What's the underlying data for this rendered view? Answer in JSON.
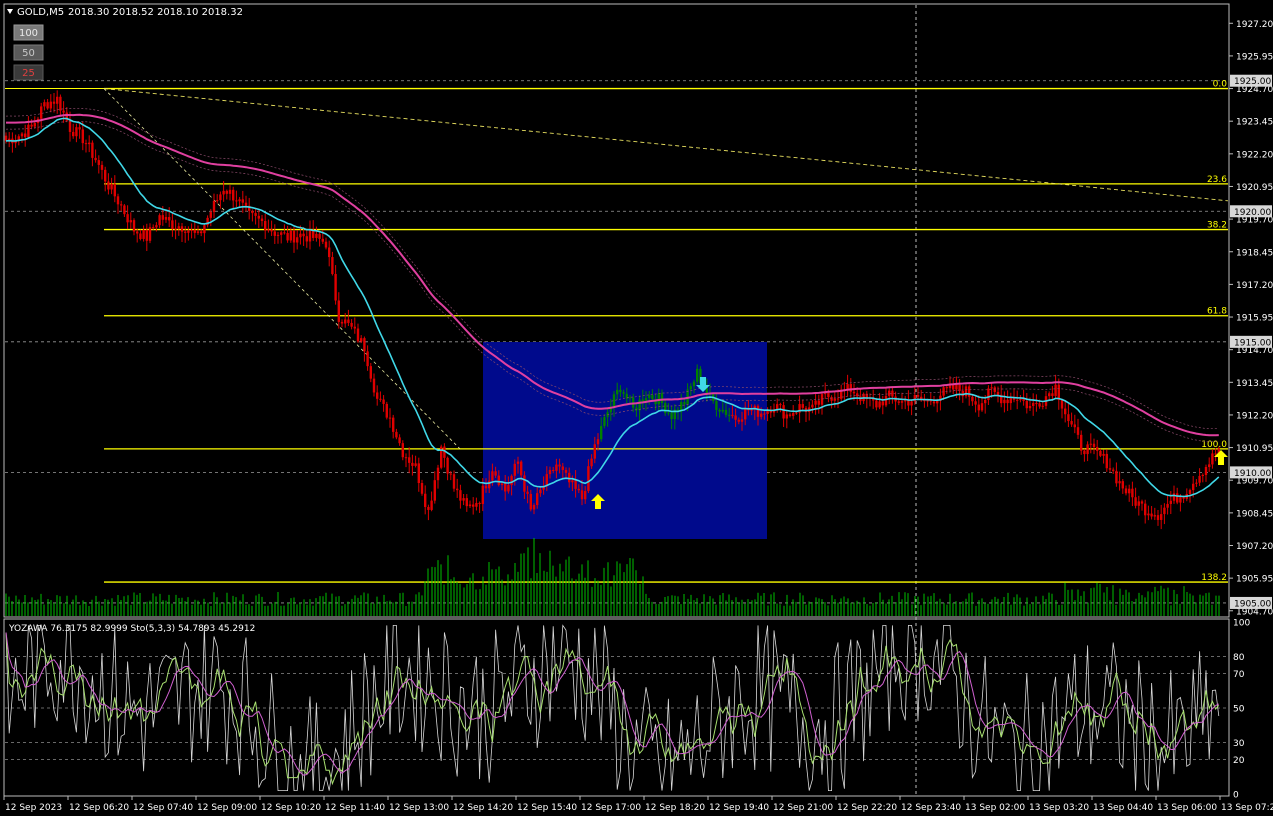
{
  "header": {
    "symbol": "GOLD,M5",
    "ohlc": "2018.30 2018.52 2018.10 2018.32"
  },
  "zoom_buttons": [
    "100",
    "50",
    "25"
  ],
  "indicator_label": "YOZAWA 76.3175 82.9999  Sto(5,3,3) 54.7893 45.2912",
  "colors": {
    "background": "#000000",
    "bear_candle": "#e00000",
    "bull_candle": "#008000",
    "fib_line": "#ffff00",
    "ma_fast": "#40d8e8",
    "ma_slow": "#e040a0",
    "box": "#000a8c",
    "volume": "#00c000"
  },
  "chart_data": {
    "type": "candlestick",
    "price_axis_ticks": [
      "1927.20",
      "1925.95",
      "1924.70",
      "1923.45",
      "1922.20",
      "1920.95",
      "1919.70",
      "1918.45",
      "1917.20",
      "1915.95",
      "1914.70",
      "1913.45",
      "1912.20",
      "1910.95",
      "1909.70",
      "1908.45",
      "1907.20",
      "1905.95",
      "1904.70"
    ],
    "price_boxes": [
      "1925.00",
      "1920.00",
      "1915.00",
      "1910.00",
      "1905.00"
    ],
    "ylim": [
      1904.5,
      1927.9
    ],
    "fib_levels": [
      {
        "label": "0.0",
        "price": 1924.7
      },
      {
        "label": "23.6",
        "price": 1921.05
      },
      {
        "label": "38.2",
        "price": 1919.3
      },
      {
        "label": "61.8",
        "price": 1916.0
      },
      {
        "label": "100.0",
        "price": 1910.9
      },
      {
        "label": "138.2",
        "price": 1905.8
      }
    ],
    "time_labels": [
      "12 Sep 2023",
      "12 Sep 06:20",
      "12 Sep 07:40",
      "12 Sep 09:00",
      "12 Sep 10:20",
      "12 Sep 11:40",
      "12 Sep 13:00",
      "12 Sep 14:20",
      "12 Sep 15:40",
      "12 Sep 17:00",
      "12 Sep 18:20",
      "12 Sep 19:40",
      "12 Sep 21:00",
      "12 Sep 22:20",
      "12 Sep 23:40",
      "13 Sep 02:00",
      "13 Sep 03:20",
      "13 Sep 04:40",
      "13 Sep 06:00",
      "13 Sep 07:20"
    ],
    "osc_ticks": [
      "100",
      "80",
      "70",
      "50",
      "30",
      "20",
      "0"
    ],
    "close_anchors": [
      [
        0,
        1922.7
      ],
      [
        4,
        1922.9
      ],
      [
        8,
        1923.2
      ],
      [
        12,
        1924.1
      ],
      [
        16,
        1924.3
      ],
      [
        20,
        1923.2
      ],
      [
        24,
        1922.8
      ],
      [
        28,
        1922.0
      ],
      [
        32,
        1921.0
      ],
      [
        36,
        1920.2
      ],
      [
        40,
        1919.3
      ],
      [
        44,
        1919.0
      ],
      [
        48,
        1919.8
      ],
      [
        52,
        1919.5
      ],
      [
        56,
        1919.4
      ],
      [
        60,
        1919.0
      ],
      [
        64,
        1920.0
      ],
      [
        68,
        1920.9
      ],
      [
        72,
        1920.5
      ],
      [
        76,
        1919.8
      ],
      [
        80,
        1919.6
      ],
      [
        84,
        1919.2
      ],
      [
        88,
        1919.0
      ],
      [
        92,
        1919.1
      ],
      [
        96,
        1919.0
      ],
      [
        100,
        1918.8
      ],
      [
        104,
        1916.0
      ],
      [
        108,
        1915.5
      ],
      [
        112,
        1914.8
      ],
      [
        116,
        1912.8
      ],
      [
        120,
        1912.1
      ],
      [
        124,
        1910.8
      ],
      [
        128,
        1910.2
      ],
      [
        132,
        1908.5
      ],
      [
        136,
        1911.0
      ],
      [
        140,
        1909.4
      ],
      [
        144,
        1908.6
      ],
      [
        148,
        1909.0
      ],
      [
        152,
        1910.2
      ],
      [
        156,
        1909.3
      ],
      [
        160,
        1910.4
      ],
      [
        164,
        1908.5
      ],
      [
        168,
        1909.5
      ],
      [
        172,
        1910.3
      ],
      [
        176,
        1909.6
      ],
      [
        180,
        1909.0
      ],
      [
        184,
        1911.0
      ],
      [
        188,
        1912.3
      ],
      [
        192,
        1913.3
      ],
      [
        196,
        1912.4
      ],
      [
        200,
        1913.0
      ],
      [
        204,
        1912.8
      ],
      [
        208,
        1912.2
      ],
      [
        212,
        1912.7
      ],
      [
        216,
        1913.8
      ],
      [
        220,
        1912.8
      ],
      [
        224,
        1912.4
      ],
      [
        228,
        1912.1
      ],
      [
        232,
        1912.4
      ],
      [
        236,
        1912.3
      ],
      [
        240,
        1912.6
      ],
      [
        244,
        1912.2
      ],
      [
        248,
        1912.5
      ],
      [
        252,
        1912.4
      ],
      [
        256,
        1912.9
      ],
      [
        260,
        1913.0
      ],
      [
        264,
        1913.2
      ],
      [
        268,
        1912.8
      ],
      [
        272,
        1912.6
      ],
      [
        276,
        1912.9
      ],
      [
        280,
        1912.7
      ],
      [
        284,
        1912.8
      ],
      [
        288,
        1912.7
      ],
      [
        292,
        1913.0
      ],
      [
        296,
        1913.2
      ],
      [
        300,
        1913.1
      ],
      [
        304,
        1912.6
      ],
      [
        308,
        1913.1
      ],
      [
        312,
        1912.8
      ],
      [
        316,
        1912.9
      ],
      [
        320,
        1912.5
      ],
      [
        324,
        1912.8
      ],
      [
        328,
        1913.3
      ],
      [
        332,
        1912.0
      ],
      [
        336,
        1911.0
      ],
      [
        340,
        1910.8
      ],
      [
        344,
        1910.4
      ],
      [
        348,
        1909.6
      ],
      [
        352,
        1909.0
      ],
      [
        356,
        1908.6
      ],
      [
        360,
        1908.4
      ],
      [
        364,
        1908.9
      ],
      [
        368,
        1909.2
      ],
      [
        372,
        1909.8
      ],
      [
        376,
        1910.4
      ],
      [
        379,
        1910.9
      ]
    ],
    "bull_range": [
      186,
      226
    ]
  }
}
